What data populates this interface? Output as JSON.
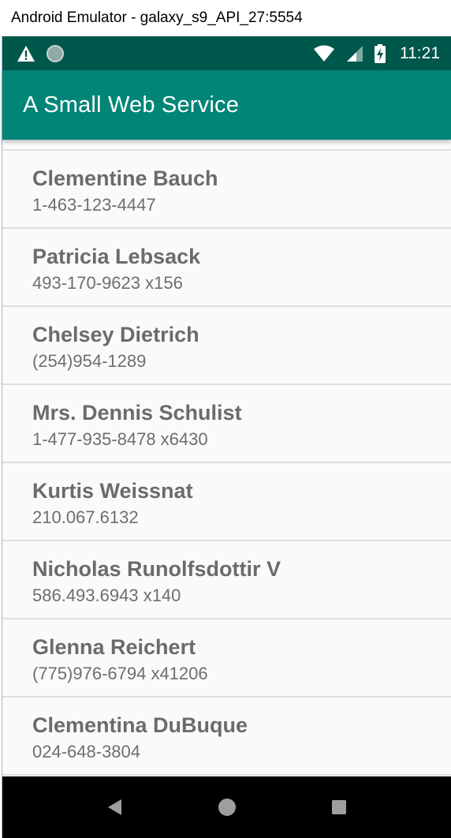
{
  "window": {
    "title": "Android Emulator - galaxy_s9_API_27:5554"
  },
  "status_bar": {
    "time": "11:21",
    "icons": [
      "warning-icon",
      "circle-icon",
      "wifi-icon",
      "signal-icon",
      "battery-charging-icon"
    ]
  },
  "app_bar": {
    "title": "A Small Web Service"
  },
  "contacts": [
    {
      "name": "Clementine Bauch",
      "phone": "1-463-123-4447"
    },
    {
      "name": "Patricia Lebsack",
      "phone": "493-170-9623 x156"
    },
    {
      "name": "Chelsey Dietrich",
      "phone": "(254)954-1289"
    },
    {
      "name": "Mrs. Dennis Schulist",
      "phone": "1-477-935-8478 x6430"
    },
    {
      "name": "Kurtis Weissnat",
      "phone": "210.067.6132"
    },
    {
      "name": "Nicholas Runolfsdottir V",
      "phone": "586.493.6943 x140"
    },
    {
      "name": "Glenna Reichert",
      "phone": "(775)976-6794 x41206"
    },
    {
      "name": "Clementina DuBuque",
      "phone": "024-648-3804"
    }
  ],
  "nav_bar": {
    "buttons": [
      "back-icon",
      "home-icon",
      "recents-icon"
    ]
  },
  "colors": {
    "status_bar": "#00574b",
    "app_bar": "#008577",
    "list_background": "#fafafa",
    "text_primary": "#6b6b6b",
    "nav_bar": "#000000"
  }
}
